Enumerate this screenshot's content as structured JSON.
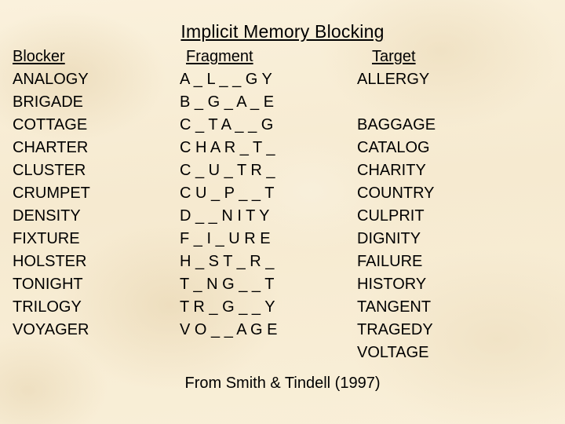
{
  "slide": {
    "title": "Implicit Memory Blocking",
    "background_color": "#f8eed6",
    "text_color": "#000000",
    "footer": "From Smith & Tindell (1997)"
  },
  "table": {
    "headers": {
      "blocker": "Blocker",
      "fragment": "Fragment",
      "target": "Target"
    },
    "rows": [
      {
        "blocker": "ANALOGY",
        "fragment": "A _ L _ _ G Y",
        "target": "ALLERGY"
      },
      {
        "blocker": "BRIGADE",
        "fragment": "B _ G _ A _ E",
        "target": ""
      },
      {
        "blocker": "COTTAGE",
        "fragment": "C _ T A _ _ G",
        "target": "BAGGAGE"
      },
      {
        "blocker": "CHARTER",
        "fragment": "C H A R _ T _",
        "target": "CATALOG"
      },
      {
        "blocker": "CLUSTER",
        "fragment": "C _ U _ T R _",
        "target": "CHARITY"
      },
      {
        "blocker": "CRUMPET",
        "fragment": "C U _ P _ _ T",
        "target": "COUNTRY"
      },
      {
        "blocker": "DENSITY",
        "fragment": "D _ _ N I T Y",
        "target": "CULPRIT"
      },
      {
        "blocker": "FIXTURE",
        "fragment": "F _ I _ U R E",
        "target": "DIGNITY"
      },
      {
        "blocker": "HOLSTER",
        "fragment": "H _ S T _ R _",
        "target": "FAILURE"
      },
      {
        "blocker": "TONIGHT",
        "fragment": "T _ N G _ _ T",
        "target": "HISTORY"
      },
      {
        "blocker": "TRILOGY",
        "fragment": "T R _ G _ _ Y",
        "target": "TANGENT"
      },
      {
        "blocker": "VOYAGER",
        "fragment": "V O _ _ A G E",
        "target": "TRAGEDY"
      },
      {
        "blocker": "",
        "fragment": "",
        "target": "VOLTAGE"
      }
    ]
  }
}
